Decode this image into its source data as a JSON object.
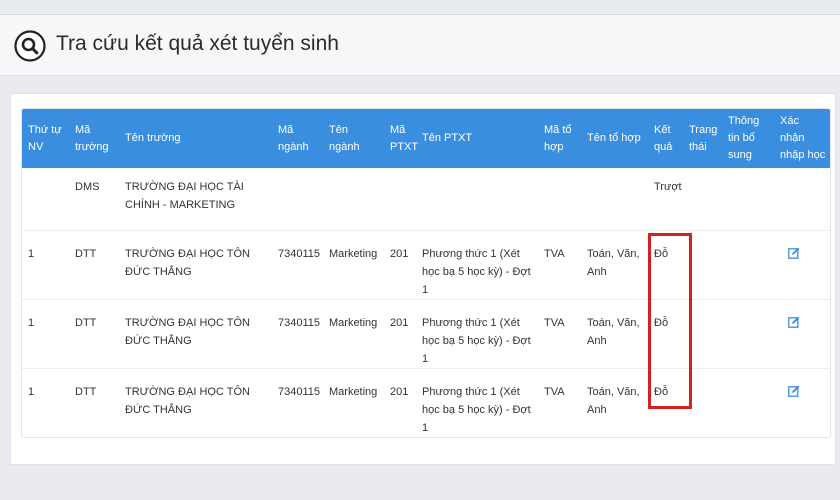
{
  "header": {
    "title": "Tra cứu kết quả xét tuyển sinh",
    "icon": "search-icon"
  },
  "table": {
    "columns": [
      "Thứ tự NV",
      "Mã trường",
      "Tên trường",
      "Mã ngành",
      "Tên ngành",
      "Mã PTXT",
      "Tên PTXT",
      "Mã tổ hợp",
      "Tên tổ hợp",
      "Kết quả",
      "Trang thái",
      "Thông tin bổ sung",
      "Xác nhận nhập học"
    ],
    "rows": [
      {
        "nv": "",
        "ma_truong": "DMS",
        "ten_truong": "TRƯỜNG ĐẠI HỌC TÀI CHÍNH - MARKETING",
        "ma_nganh": "",
        "ten_nganh": "",
        "ma_ptxt": "",
        "ten_ptxt": "",
        "ma_to_hop": "",
        "ten_to_hop": "",
        "ket_qua": "Trượt",
        "trang_thai": "",
        "thong_tin": "",
        "has_edit": false
      },
      {
        "nv": "1",
        "ma_truong": "DTT",
        "ten_truong": "TRƯỜNG ĐẠI HỌC TÔN ĐỨC THẮNG",
        "ma_nganh": "7340115",
        "ten_nganh": "Marketing",
        "ma_ptxt": "201",
        "ten_ptxt": "Phương thức 1 (Xét học bạ 5 học kỳ) - Đợt 1",
        "ma_to_hop": "TVA",
        "ten_to_hop": "Toán, Văn, Anh",
        "ket_qua": "Đỗ",
        "trang_thai": "",
        "thong_tin": "",
        "has_edit": true
      },
      {
        "nv": "1",
        "ma_truong": "DTT",
        "ten_truong": "TRƯỜNG ĐẠI HỌC TÔN ĐỨC THẮNG",
        "ma_nganh": "7340115",
        "ten_nganh": "Marketing",
        "ma_ptxt": "201",
        "ten_ptxt": "Phương thức 1 (Xét học bạ 5 học kỳ) - Đợt 1",
        "ma_to_hop": "TVA",
        "ten_to_hop": "Toán, Văn, Anh",
        "ket_qua": "Đỗ",
        "trang_thai": "",
        "thong_tin": "",
        "has_edit": true
      },
      {
        "nv": "1",
        "ma_truong": "DTT",
        "ten_truong": "TRƯỜNG ĐẠI HỌC TÔN ĐỨC THẮNG",
        "ma_nganh": "7340115",
        "ten_nganh": "Marketing",
        "ma_ptxt": "201",
        "ten_ptxt": "Phương thức 1 (Xét học bạ 5 học kỳ) - Đợt 1",
        "ma_to_hop": "TVA",
        "ten_to_hop": "Toán, Văn, Anh",
        "ket_qua": "Đỗ",
        "trang_thai": "",
        "thong_tin": "",
        "has_edit": true
      }
    ]
  },
  "colors": {
    "header_bg": "#3a8ee0",
    "highlight": "#d42222",
    "edit_icon": "#3a8ee0"
  }
}
